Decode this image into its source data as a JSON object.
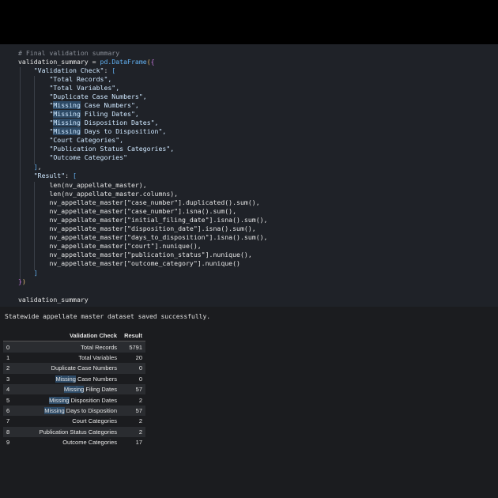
{
  "code": {
    "comment": "# Final validation summary",
    "assign_var": "validation_summary",
    "assign_op": " = ",
    "module": "pd",
    "constructor": ".DataFrame",
    "key_check": "\"Validation Check\"",
    "key_result": "\"Result\"",
    "check_items": [
      {
        "pre": "\"Total Records\"",
        "hl": "",
        "post": ","
      },
      {
        "pre": "\"Total Variables\"",
        "hl": "",
        "post": ","
      },
      {
        "pre": "\"Duplicate Case Numbers\"",
        "hl": "",
        "post": ","
      },
      {
        "pre": "\"",
        "hl": "Missing",
        "post": " Case Numbers\","
      },
      {
        "pre": "\"",
        "hl": "Missing",
        "post": " Filing Dates\","
      },
      {
        "pre": "\"",
        "hl": "Missing",
        "post": " Disposition Dates\","
      },
      {
        "pre": "\"",
        "hl": "Missing",
        "post": " Days to Disposition\","
      },
      {
        "pre": "\"Court Categories\"",
        "hl": "",
        "post": ","
      },
      {
        "pre": "\"Publication Status Categories\"",
        "hl": "",
        "post": ","
      },
      {
        "pre": "\"Outcome Categories\"",
        "hl": "",
        "post": ""
      }
    ],
    "result_items": [
      "len(nv_appellate_master),",
      "len(nv_appellate_master.columns),",
      "nv_appellate_master[\"case_number\"].duplicated().sum(),",
      "nv_appellate_master[\"case_number\"].isna().sum(),",
      "nv_appellate_master[\"initial_filing_date\"].isna().sum(),",
      "nv_appellate_master[\"disposition_date\"].isna().sum(),",
      "nv_appellate_master[\"days_to_disposition\"].isna().sum(),",
      "nv_appellate_master[\"court\"].nunique(),",
      "nv_appellate_master[\"publication_status\"].nunique(),",
      "nv_appellate_master[\"outcome_category\"].nunique()"
    ],
    "final_expr": "validation_summary"
  },
  "output": {
    "stdout": "Statewide appellate master dataset saved successfully.",
    "table": {
      "headers": [
        "",
        "Validation Check",
        "Result"
      ],
      "rows": [
        {
          "idx": "0",
          "check": "Total Records",
          "result": "5791"
        },
        {
          "idx": "1",
          "check": "Total Variables",
          "result": "20"
        },
        {
          "idx": "2",
          "check": "Duplicate Case Numbers",
          "result": "0"
        },
        {
          "idx": "3",
          "check": "Missing Case Numbers",
          "result": "0"
        },
        {
          "idx": "4",
          "check": "Missing Filing Dates",
          "result": "57"
        },
        {
          "idx": "5",
          "check": "Missing Disposition Dates",
          "result": "2"
        },
        {
          "idx": "6",
          "check": "Missing Days to Disposition",
          "result": "57"
        },
        {
          "idx": "7",
          "check": "Court Categories",
          "result": "2"
        },
        {
          "idx": "8",
          "check": "Publication Status Categories",
          "result": "2"
        },
        {
          "idx": "9",
          "check": "Outcome Categories",
          "result": "17"
        }
      ]
    }
  }
}
